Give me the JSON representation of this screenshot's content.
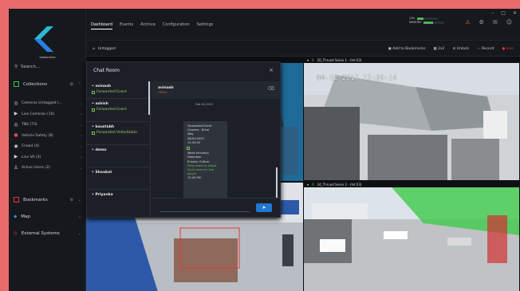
{
  "window": {
    "controls": [
      "–",
      "□",
      "✕"
    ]
  },
  "sidebar": {
    "brand": "Videonetics",
    "search_placeholder": "Search...",
    "collections_label": "Collections",
    "collections": [
      {
        "label": "Cameras Untagged (...",
        "icon": "camera-icon",
        "color": "#d0d4da"
      },
      {
        "label": "Live Cameras (10)",
        "icon": "video-icon",
        "color": "#d0d4da"
      },
      {
        "label": "TNS (73)",
        "icon": "camera-icon",
        "color": "#d0d4da"
      },
      {
        "label": "Vehicle Safety (8)",
        "icon": "alert-icon",
        "color": "#e34b4b"
      },
      {
        "label": "Crowd (4)",
        "icon": "crowd-icon",
        "color": "#d0d4da"
      },
      {
        "label": "Live VA (3)",
        "icon": "video-icon",
        "color": "#d0d4da"
      },
      {
        "label": "Active Users (2)",
        "icon": "user-icon",
        "color": "#d0d4da"
      }
    ],
    "bookmarks_label": "Bookmarks",
    "maps_label": "Map",
    "external_label": "External Systems"
  },
  "topbar": {
    "tabs": [
      "Dashboard",
      "Events",
      "Archive",
      "Configuration",
      "Settings"
    ],
    "active_tab": "Dashboard",
    "meters": [
      {
        "label": "CPU",
        "value": 0.3
      },
      {
        "label": "MEMORY",
        "value": 0.45
      }
    ]
  },
  "subbar": {
    "untagged": "Untagged",
    "add_bookmarks": "Add to Bookmarks",
    "layout": "2x2",
    "unlock": "Unlock",
    "record": "Record",
    "live": "Live"
  },
  "tiles": [
    {
      "title": "",
      "num": ""
    },
    {
      "title": "20_Thruxd Senio 1 - (hd 03)",
      "num": "9",
      "timestamp": "00-12-2017  17:39:14"
    },
    {
      "title": "",
      "num": ""
    },
    {
      "title": "24_Thruxd Senio 2 - (hd 03)",
      "num": "9"
    }
  ],
  "chat": {
    "title": "Chat Room",
    "contacts": [
      {
        "name": "avinash",
        "sub": "Forwarded Event",
        "icon": true
      },
      {
        "name": "ashish",
        "sub": "Forwarded Event",
        "icon": true
      },
      {
        "name": "kaustubh",
        "sub": "Forwarded VideoStatio",
        "icon": true
      },
      {
        "name": "demo",
        "sub": ""
      },
      {
        "name": "Shoukat",
        "sub": ""
      },
      {
        "name": "Priyanka",
        "sub": ""
      }
    ],
    "active": {
      "name": "avinash",
      "status": "Offline"
    },
    "date": "Feb 06 2023",
    "bubble": {
      "lines": [
        "Forwarded Event",
        "Camera : Drive",
        "Way",
        "06/02/2023",
        "12:45:02"
      ],
      "lines2": [
        "Weak Intrusion",
        "Detection",
        "Priority: Critical"
      ],
      "green": [
        "View event in player",
        "Go to event in live",
        "player"
      ],
      "time": "12:45 PM"
    },
    "send_icon": "send-icon"
  }
}
